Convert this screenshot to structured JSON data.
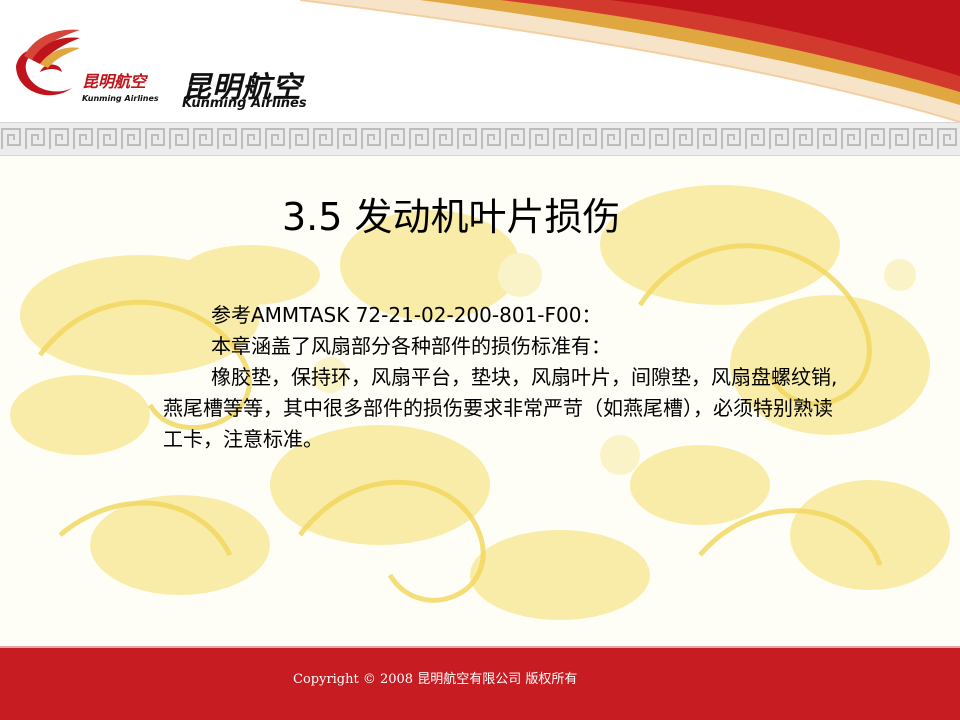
{
  "brand": {
    "small_cn": "昆明航空",
    "small_en": "Kunming Airlines",
    "big_cn": "昆明航空",
    "big_en": "Kunming Airlines",
    "icon": "phoenix-logo-icon"
  },
  "slide": {
    "title": "3.5 发动机叶片损伤",
    "paragraphs": [
      "参考AMMTASK  72-21-02-200-801-F00：",
      "本章涵盖了风扇部分各种部件的损伤标准有：",
      "橡胶垫，保持环，风扇平台，垫块，风扇叶片，间隙垫，风扇盘螺纹销,燕尾槽等等，其中很多部件的损伤要求非常严苛（如燕尾槽），必须特别熟读工卡，注意标准。"
    ]
  },
  "footer": {
    "copyright": "Copyright  © 2008 昆明航空有限公司  版权所有"
  },
  "colors": {
    "brand_red": "#c71d22",
    "title_text": "#000000",
    "watermark": "#f5e27a"
  }
}
